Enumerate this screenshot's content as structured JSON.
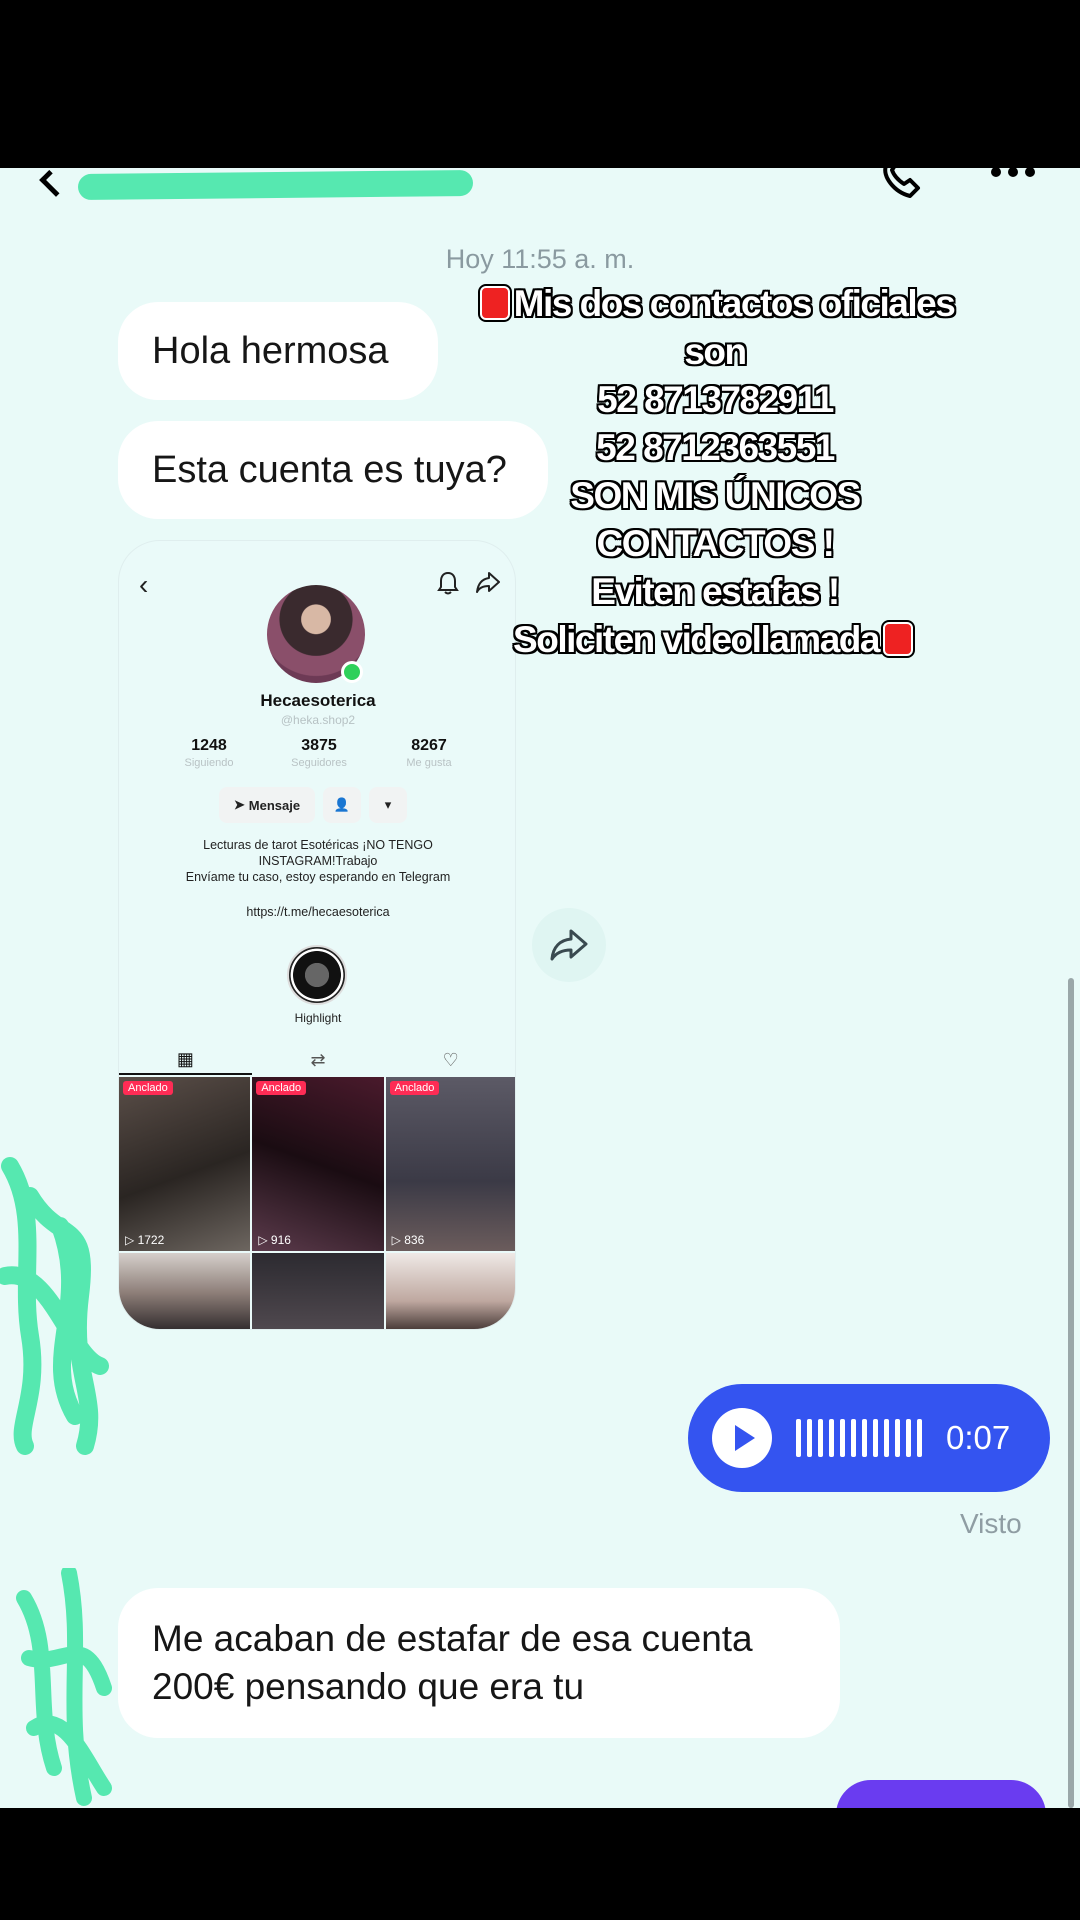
{
  "chat": {
    "timestamp": "Hoy 11:55 a. m.",
    "messages": {
      "m1": "Hola hermosa",
      "m2": "Esta cuenta es tuya?",
      "m3": "Me acaban de estafar de esa cuenta\n200€ pensando que era tu"
    },
    "voice_note": {
      "duration": "0:07"
    },
    "seen_label": "Visto"
  },
  "overlay_caption": {
    "line1": "Mis dos contactos oficiales",
    "line2": "son",
    "line3": "52 8713782911",
    "line4": "52 8712363551",
    "line5": "SON MIS ÚNICOS",
    "line6": "CONTACTOS !",
    "line7": "Eviten estafas !",
    "line8": "Soliciten videollamada"
  },
  "profile_card": {
    "name": "Hecaesoterica",
    "handle": "@heka.shop2",
    "stats": [
      {
        "value": "1248",
        "label": "Siguiendo"
      },
      {
        "value": "3875",
        "label": "Seguidores"
      },
      {
        "value": "8267",
        "label": "Me gusta"
      }
    ],
    "message_button": "Mensaje",
    "bio": "Lecturas de tarot Esotéricas ¡NO TENGO\nINSTAGRAM!Trabajo\nEnvíame tu caso, estoy esperando en Telegram",
    "link": "https://t.me/hecaesoterica",
    "highlight_label": "Highlight",
    "videos": [
      {
        "pinned": "Anclado",
        "views": "1722"
      },
      {
        "pinned": "Anclado",
        "views": "916"
      },
      {
        "pinned": "Anclado",
        "views": "836"
      }
    ]
  },
  "colors": {
    "background": "#e9faf8",
    "voice_bubble": "#3454f0",
    "scribble": "#56e8b0"
  }
}
